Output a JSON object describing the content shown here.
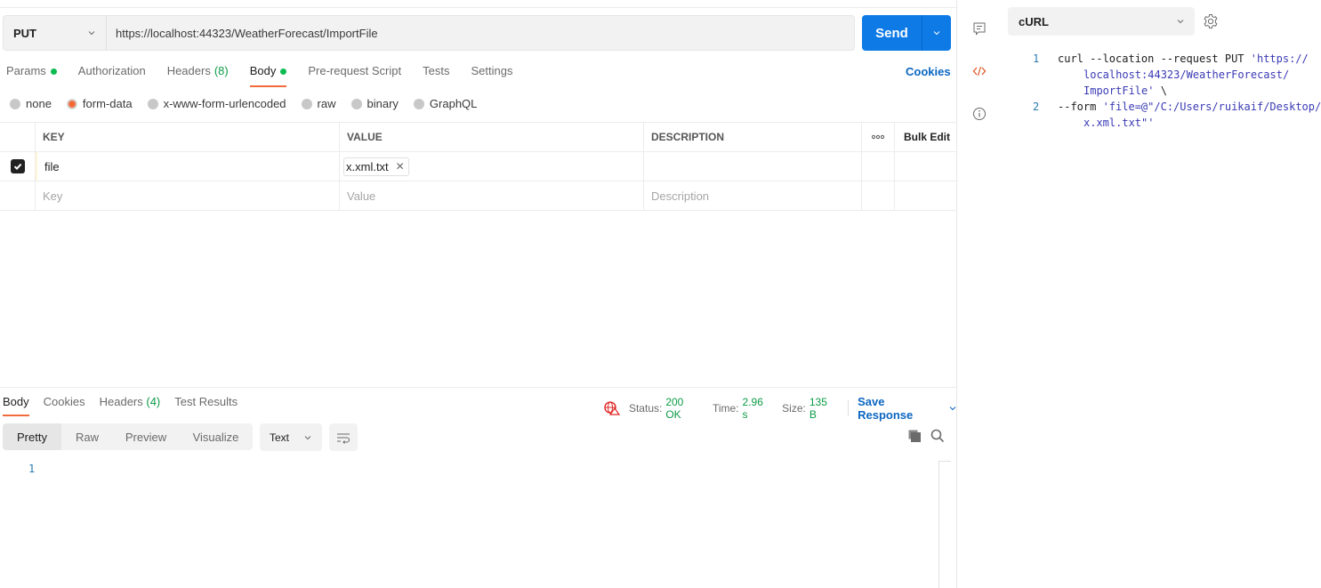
{
  "request": {
    "method": "PUT",
    "url": "https://localhost:44323/WeatherForecast/ImportFile",
    "send_label": "Send",
    "tabs": [
      {
        "label": "Params",
        "dot": true,
        "active": false
      },
      {
        "label": "Authorization",
        "active": false
      },
      {
        "label": "Headers",
        "count": "(8)",
        "active": false
      },
      {
        "label": "Body",
        "dot": true,
        "active": true
      },
      {
        "label": "Pre-request Script",
        "active": false
      },
      {
        "label": "Tests",
        "active": false
      },
      {
        "label": "Settings",
        "active": false
      }
    ],
    "cookies_label": "Cookies",
    "body_types": [
      {
        "label": "none",
        "selected": false
      },
      {
        "label": "form-data",
        "selected": true
      },
      {
        "label": "x-www-form-urlencoded",
        "selected": false
      },
      {
        "label": "raw",
        "selected": false
      },
      {
        "label": "binary",
        "selected": false
      },
      {
        "label": "GraphQL",
        "selected": false
      }
    ],
    "form_table": {
      "headers": {
        "key": "KEY",
        "value": "VALUE",
        "description": "DESCRIPTION",
        "more": "ooo",
        "bulk_edit": "Bulk Edit"
      },
      "rows": [
        {
          "checked": true,
          "key": "file",
          "value_file": "x.xml.txt",
          "description": ""
        }
      ],
      "placeholders": {
        "key": "Key",
        "value": "Value",
        "description": "Description"
      }
    }
  },
  "response": {
    "tabs": [
      {
        "label": "Body",
        "active": true
      },
      {
        "label": "Cookies",
        "active": false
      },
      {
        "label": "Headers",
        "count": "(4)",
        "active": false
      },
      {
        "label": "Test Results",
        "active": false
      }
    ],
    "status_label": "Status:",
    "status_value": "200 OK",
    "time_label": "Time:",
    "time_value": "2.96 s",
    "size_label": "Size:",
    "size_value": "135 B",
    "save_response_label": "Save Response",
    "view_modes": [
      "Pretty",
      "Raw",
      "Preview",
      "Visualize"
    ],
    "active_view_mode": "Pretty",
    "format": "Text",
    "lines": [
      "1"
    ]
  },
  "code_panel": {
    "language": "cURL",
    "lines": [
      {
        "num": "1",
        "parts": [
          "curl --location --request PUT ",
          "'https://"
        ],
        "cont": [
          "localhost:44323/WeatherForecast/",
          "ImportFile'"
        ],
        "tail": " \\"
      },
      {
        "num": "2",
        "parts": [
          "--form ",
          "'file=@\"/C:/Users/ruikaif/Desktop/"
        ],
        "cont": [
          "x.xml.txt\"'"
        ]
      }
    ]
  },
  "colors": {
    "accent_orange": "#f26b3a",
    "primary_blue": "#0d7ae6",
    "link_blue": "#0b66c2",
    "status_green": "#0c9b46",
    "dot_green": "#0cbb52"
  }
}
